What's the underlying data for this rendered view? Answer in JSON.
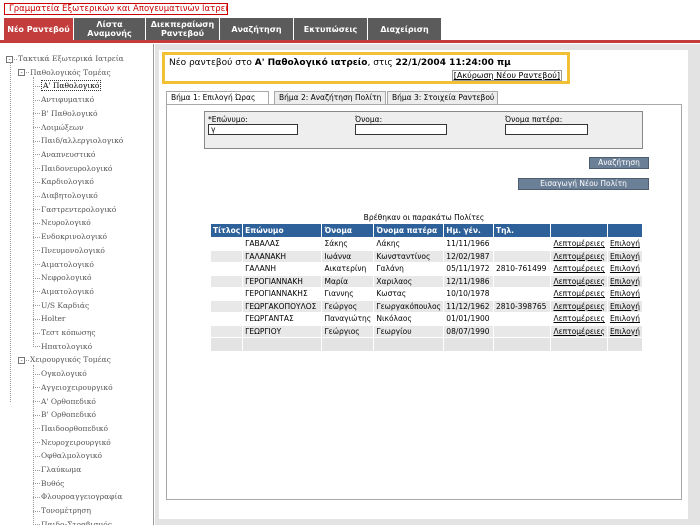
{
  "app": {
    "title": "Γραμματεία Εξωτερικών και Απογευματινών Ιατρείων"
  },
  "nav": {
    "tabs": [
      {
        "label": "Νέο Ραντεβού",
        "active": true
      },
      {
        "label": "Λίστα Αναμονής",
        "active": false
      },
      {
        "label": "Διεκπεραίωση Ραντεβού",
        "active": false
      },
      {
        "label": "Αναζήτηση",
        "active": false
      },
      {
        "label": "Εκτυπώσεις",
        "active": false
      },
      {
        "label": "Διαχείριση",
        "active": false
      }
    ]
  },
  "sidebar": {
    "root": "Τακτικά Εξωτερικά Ιατρεία",
    "groups": [
      {
        "label": "Παθολογικός Τομέας",
        "items": [
          "Α' Παθολογικό",
          "Αντιφυματικό",
          "Β' Παθολογικό",
          "Λοιμώξεων",
          "Παιδ/αλλεργιολογικό",
          "Αναπνευστικό",
          "Παιδονευρολογικό",
          "Καρδιολογικό",
          "Διαβητολογικό",
          "Γαστρεντερολογικό",
          "Νευρολογικό",
          "Ενδοκρινολογικό",
          "Πνευμονολογικό",
          "Αιματολογικό",
          "Νεφρολογικό",
          "Αιματολογικό",
          "U/S Καρδιάς",
          "Holter",
          "Τεστ κόπωσης",
          "Ηπατολογικό"
        ],
        "selected_index": 0
      },
      {
        "label": "Χειρουργικός Τομέας",
        "items": [
          "Ογκολογικό",
          "Αγγειοχειρουργικό",
          "Α' Ορθοπεδικό",
          "Β' Ορθοπεδικό",
          "Παιδοορθοπεδικό",
          "Νευροχειρουργικό",
          "Οφθαλμολογικό",
          "Γλαύκωμα",
          "Βυθός",
          "Φλουροαγγειογραφία",
          "Τονομέτρηση",
          "Παιδο-Στραβισμός"
        ]
      }
    ]
  },
  "appointment": {
    "prefix": "Νέο ραντεβού στο",
    "clinic": "Α' Παθολογικό ιατρείο",
    "middle": ", στις",
    "datetime": "22/1/2004 11:24:00 πμ",
    "cancel_label": "[Ακύρωση Νέου Ραντεβού]"
  },
  "steps": {
    "tabs": [
      {
        "label": "Βήμα 1: Επιλογή Ώρας",
        "active": true
      },
      {
        "label": "Βήμα 2: Αναζήτηση Πολίτη",
        "active": false
      },
      {
        "label": "Βήμα 3: Στοιχεία Ραντεβού",
        "active": false
      }
    ]
  },
  "search": {
    "surname_label": "*Επώνυμο:",
    "surname_value": "γ",
    "name_label": "Όνομα:",
    "name_value": "",
    "father_label": "Όνομα πατέρα:",
    "father_value": "",
    "search_button": "Αναζήτηση",
    "add_button": "Εισαγωγή Νέου Πολίτη"
  },
  "results": {
    "caption": "Βρέθηκαν οι παρακάτω Πολίτες",
    "columns": [
      "Τίτλος",
      "Επώνυμο",
      "Όνομα",
      "Όνομα πατέρα",
      "Ημ. γέν.",
      "Τηλ.",
      "",
      ""
    ],
    "rows": [
      {
        "title": "",
        "surname": "ΓΑΒΑΛΑΣ",
        "name": "Σάκης",
        "father": "Λάκης",
        "dob": "11/11/1966",
        "phone": "",
        "details": "Λεπτομέρειες",
        "select": "Επιλογή"
      },
      {
        "title": "",
        "surname": "ΓΑΛΑΝΑΚΗ",
        "name": "Ιωάννα",
        "father": "Κωνσταντίνος",
        "dob": "12/02/1987",
        "phone": "",
        "details": "Λεπτομέρειες",
        "select": "Επιλογή"
      },
      {
        "title": "",
        "surname": "ΓΑΛΑΝΗ",
        "name": "Αικατερίνη",
        "father": "Γαλάνη",
        "dob": "05/11/1972",
        "phone": "2810-761499",
        "details": "Λεπτομέρειες",
        "select": "Επιλογή"
      },
      {
        "title": "",
        "surname": "ΓΕΡΟΓΙΑΝΝΑΚΗ",
        "name": "Μαρία",
        "father": "Χαριλαος",
        "dob": "12/11/1986",
        "phone": "",
        "details": "Λεπτομέρειες",
        "select": "Επιλογή"
      },
      {
        "title": "",
        "surname": "ΓΕΡΟΓΙΑΝΝΑΚΗΣ",
        "name": "Γιαννης",
        "father": "Κωστας",
        "dob": "10/10/1978",
        "phone": "",
        "details": "Λεπτομέρειες",
        "select": "Επιλογή"
      },
      {
        "title": "",
        "surname": "ΓΕΩΡΓΑΚΟΠΟΥΛΟΣ",
        "name": "Γεώργος",
        "father": "Γεωργακόπουλος",
        "dob": "11/12/1962",
        "phone": "2810-398765",
        "details": "Λεπτομέρειες",
        "select": "Επιλογή"
      },
      {
        "title": "",
        "surname": "ΓΕΩΡΓΑΝΤΑΣ",
        "name": "Παναγιώτης",
        "father": "Νικόλαος",
        "dob": "01/01/1900",
        "phone": "",
        "details": "Λεπτομέρειες",
        "select": "Επιλογή"
      },
      {
        "title": "",
        "surname": "ΓΕΩΡΓΙΟΥ",
        "name": "Γεώργιος",
        "father": "Γεωργίου",
        "dob": "08/07/1990",
        "phone": "",
        "details": "Λεπτομέρειες",
        "select": "Επιλογή"
      }
    ]
  }
}
